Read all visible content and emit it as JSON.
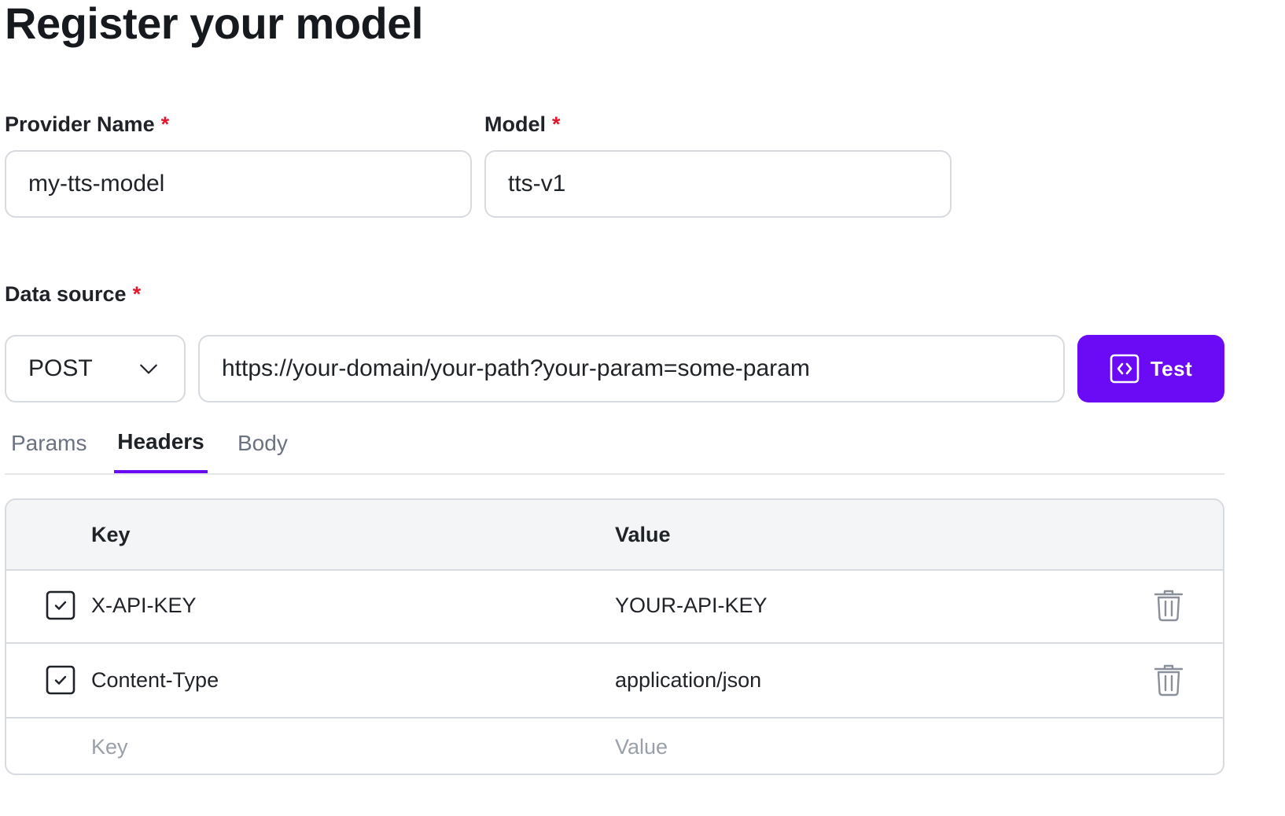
{
  "page": {
    "title": "Register your model"
  },
  "form": {
    "provider_name": {
      "label": "Provider Name",
      "required_marker": "*",
      "value": "my-tts-model"
    },
    "model": {
      "label": "Model",
      "required_marker": "*",
      "value": "tts-v1"
    },
    "data_source": {
      "label": "Data source",
      "required_marker": "*",
      "method": "POST",
      "url": "https://your-domain/your-path?your-param=some-param",
      "test_button_label": "Test"
    }
  },
  "tabs": [
    {
      "label": "Params",
      "active": false
    },
    {
      "label": "Headers",
      "active": true
    },
    {
      "label": "Body",
      "active": false
    }
  ],
  "headers_table": {
    "columns": {
      "key": "Key",
      "value": "Value"
    },
    "rows": [
      {
        "checked": true,
        "key": "X-API-KEY",
        "value": "YOUR-API-KEY"
      },
      {
        "checked": true,
        "key": "Content-Type",
        "value": "application/json"
      }
    ],
    "new_row": {
      "key_placeholder": "Key",
      "value_placeholder": "Value"
    }
  },
  "colors": {
    "accent": "#6b0af4",
    "required": "#e5162b",
    "border": "#d7dadf",
    "table_header_bg": "#f4f5f7",
    "muted_text": "#6b7280",
    "placeholder_text": "#9aa0a9"
  },
  "icons": {
    "method_dropdown": "chevron-down-icon",
    "test_button": "code-icon",
    "row_checkbox": "checkbox-checked-icon",
    "row_delete": "trash-icon"
  }
}
